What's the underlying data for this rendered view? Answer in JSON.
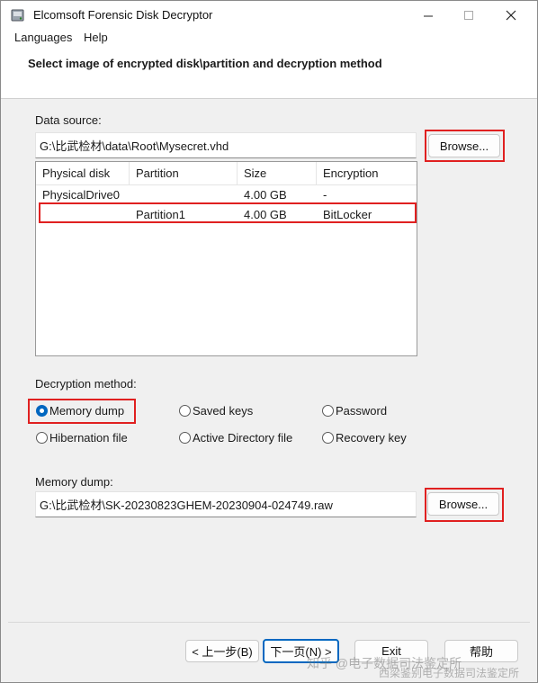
{
  "window": {
    "title": "Elcomsoft Forensic Disk Decryptor"
  },
  "menu": {
    "languages": "Languages",
    "help": "Help"
  },
  "header": {
    "text": "Select image of encrypted disk\\partition and decryption method"
  },
  "data_source": {
    "label": "Data source:",
    "path": "G:\\比武检材\\data\\Root\\Mysecret.vhd",
    "browse": "Browse..."
  },
  "table": {
    "columns": [
      "Physical disk",
      "Partition",
      "Size",
      "Encryption"
    ],
    "rows": [
      [
        "PhysicalDrive0",
        "",
        "4.00 GB",
        "-"
      ],
      [
        "",
        "Partition1",
        "4.00 GB",
        "BitLocker"
      ]
    ]
  },
  "decryption": {
    "label": "Decryption method:",
    "options": [
      "Memory dump",
      "Saved keys",
      "Password",
      "Hibernation file",
      "Active Directory file",
      "Recovery key"
    ],
    "selected": "Memory dump"
  },
  "memory_dump": {
    "label": "Memory dump:",
    "path": "G:\\比武检材\\SK-20230823GHEM-20230904-024749.raw",
    "browse": "Browse..."
  },
  "buttons": {
    "back": "< 上一步(B)",
    "next": "下一页(N) >",
    "exit": "Exit",
    "help": "帮助"
  },
  "watermark": {
    "line1": "知乎 @电子数据司法鉴定所",
    "line2": "西梁鉴别电子数据司法鉴定所"
  }
}
